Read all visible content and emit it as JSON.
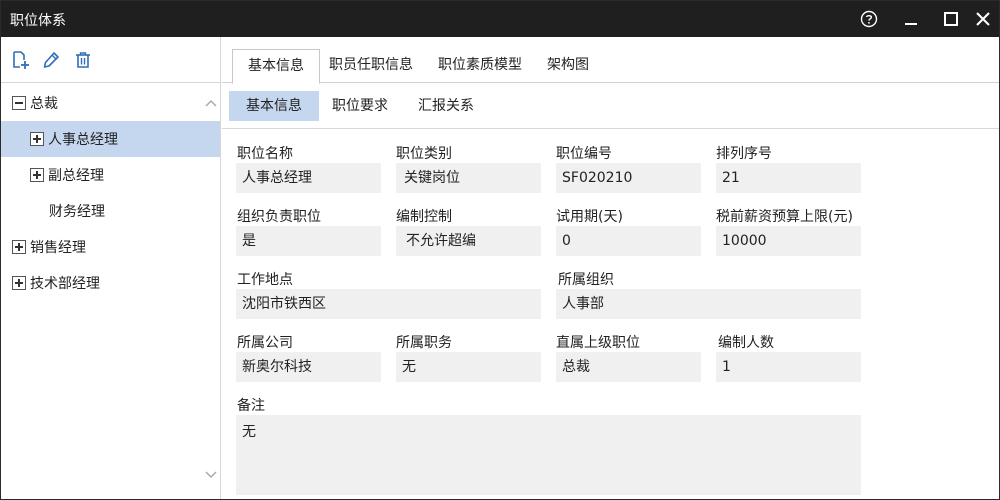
{
  "window": {
    "title": "职位体系"
  },
  "toolbar": {
    "icons": [
      "add-icon",
      "edit-icon",
      "delete-icon"
    ]
  },
  "tree": {
    "items": [
      {
        "label": "总裁",
        "expander": "minus"
      },
      {
        "label": "人事总经理",
        "expander": "plus",
        "selected": true
      },
      {
        "label": "副总经理",
        "expander": "plus"
      },
      {
        "label": "财务经理",
        "expander": "none"
      },
      {
        "label": "销售经理",
        "expander": "plus"
      },
      {
        "label": "技术部经理",
        "expander": "plus"
      }
    ]
  },
  "tabs": [
    "基本信息",
    "职员任职信息",
    "职位素质模型",
    "架构图"
  ],
  "subtabs": [
    "基本信息",
    "职位要求",
    "汇报关系"
  ],
  "form": {
    "position_name": {
      "label": "职位名称",
      "value": "人事总经理"
    },
    "position_type": {
      "label": "职位类别",
      "value": "关键岗位"
    },
    "position_code": {
      "label": "职位编号",
      "value": "SF020210"
    },
    "sort_order": {
      "label": "排列序号",
      "value": "21"
    },
    "org_head": {
      "label": "组织负责职位",
      "value": "是"
    },
    "staffing_control": {
      "label": "编制控制",
      "value": "不允许超编"
    },
    "probation": {
      "label": "试用期(天)",
      "value": "0"
    },
    "salary_cap": {
      "label": "税前薪资预算上限(元)",
      "value": "10000"
    },
    "work_location": {
      "label": "工作地点",
      "value": "沈阳市铁西区"
    },
    "organization": {
      "label": "所属组织",
      "value": "人事部"
    },
    "company": {
      "label": "所属公司",
      "value": "新奥尔科技"
    },
    "duty": {
      "label": "所属职务",
      "value": "无"
    },
    "superior": {
      "label": "直属上级职位",
      "value": "总裁"
    },
    "headcount": {
      "label": "编制人数",
      "value": "1"
    },
    "remarks": {
      "label": "备注",
      "value": "无"
    }
  },
  "colors": {
    "titlebar": "#1f1f1f",
    "selection": "#c5d7ef",
    "field_bg": "#f0f0f0",
    "icon_blue": "#2f6fb6"
  }
}
